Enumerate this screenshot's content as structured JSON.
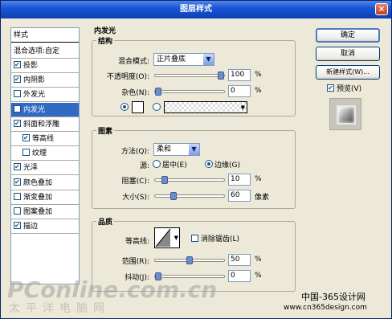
{
  "window": {
    "title": "图层样式",
    "close_glyph": "×"
  },
  "style_list": {
    "header": "样式",
    "blend_options": "混合选项:自定",
    "items": [
      {
        "label": "投影",
        "checked": true
      },
      {
        "label": "内阴影",
        "checked": true
      },
      {
        "label": "外发光",
        "checked": false
      },
      {
        "label": "内发光",
        "checked": true,
        "selected": true
      },
      {
        "label": "斜面和浮雕",
        "checked": true
      },
      {
        "label": "等高线",
        "checked": true,
        "sub": true
      },
      {
        "label": "纹理",
        "checked": false,
        "sub": true
      },
      {
        "label": "光泽",
        "checked": true
      },
      {
        "label": "颜色叠加",
        "checked": true
      },
      {
        "label": "渐变叠加",
        "checked": false
      },
      {
        "label": "图案叠加",
        "checked": false
      },
      {
        "label": "描边",
        "checked": true
      }
    ]
  },
  "panel": {
    "title": "内发光",
    "structure": {
      "title": "结构",
      "blend_mode_label": "混合模式:",
      "blend_mode_value": "正片叠底",
      "opacity_label": "不透明度(O):",
      "opacity_value": "100",
      "opacity_unit": "%",
      "opacity_fraction": 1.0,
      "noise_label": "杂色(N):",
      "noise_value": "0",
      "noise_unit": "%",
      "noise_fraction": 0.0
    },
    "elements": {
      "title": "图素",
      "method_label": "方法(Q):",
      "method_value": "柔和",
      "source_label": "源:",
      "source_center": "居中(E)",
      "source_edge": "边缘(G)",
      "choke_label": "阻塞(C):",
      "choke_value": "10",
      "choke_unit": "%",
      "choke_fraction": 0.1,
      "size_label": "大小(S):",
      "size_value": "60",
      "size_unit": "像素",
      "size_fraction": 0.24
    },
    "quality": {
      "title": "品质",
      "contour_label": "等高线:",
      "antialias_label": "消除锯齿(L)",
      "range_label": "范围(R):",
      "range_value": "50",
      "range_unit": "%",
      "range_fraction": 0.5,
      "jitter_label": "抖动(J):",
      "jitter_value": "0",
      "jitter_unit": "%",
      "jitter_fraction": 0.0
    }
  },
  "buttons": {
    "ok": "确定",
    "cancel": "取消",
    "new_style": "新建样式(W)...",
    "preview_label": "预览(V)"
  },
  "watermark": {
    "logo": "PConline.com.cn",
    "subtitle": "太平洋电脑网"
  },
  "site": {
    "name": "中国-365设计网",
    "url": "www.cn365design.com"
  }
}
